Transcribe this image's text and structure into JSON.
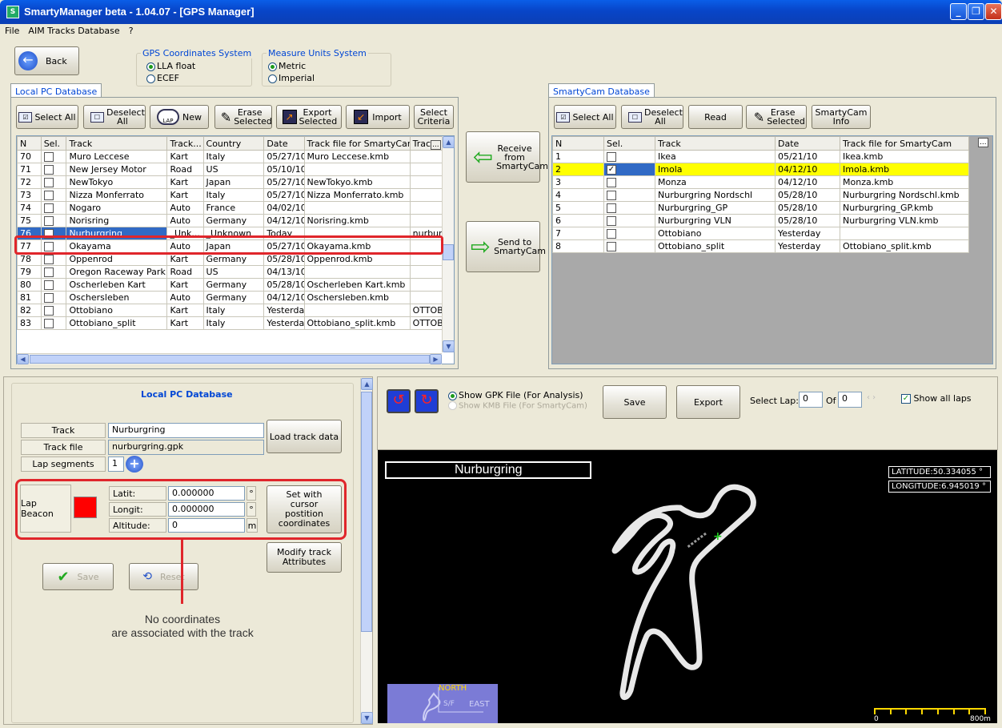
{
  "window": {
    "title": "SmartyManager beta - 1.04.07 - [GPS Manager]"
  },
  "menu": [
    "File",
    "AIM Tracks Database",
    "?"
  ],
  "top": {
    "back": "Back",
    "gps_group": "GPS Coordinates System",
    "gps_opts": [
      "LLA float",
      "ECEF"
    ],
    "units_group": "Measure Units System",
    "units_opts": [
      "Metric",
      "Imperial"
    ]
  },
  "local": {
    "tab": "Local PC Database",
    "toolbar": {
      "select_all": "Select All",
      "deselect_all": "Deselect All",
      "new": "New",
      "erase": "Erase Selected",
      "export": "Export Selected",
      "import": "Import",
      "criteria": "Select Criteria"
    },
    "columns": [
      "N",
      "Sel.",
      "Track",
      "Track...",
      "Country",
      "Date",
      "Track file for SmartyCam",
      "Trac"
    ],
    "rows": [
      [
        "70",
        "",
        "Muro Leccese",
        "Kart",
        "Italy",
        "05/27/10",
        "Muro Leccese.kmb",
        ""
      ],
      [
        "71",
        "",
        "New Jersey Motor",
        "Road",
        "US",
        "05/10/10",
        "",
        ""
      ],
      [
        "72",
        "",
        "NewTokyo",
        "Kart",
        "Japan",
        "05/27/10",
        "NewTokyo.kmb",
        ""
      ],
      [
        "73",
        "",
        "Nizza Monferrato",
        "Kart",
        "Italy",
        "05/27/10",
        "Nizza Monferrato.kmb",
        ""
      ],
      [
        "74",
        "",
        "Nogaro",
        "Auto",
        "France",
        "04/02/10",
        "",
        ""
      ],
      [
        "75",
        "",
        "Norisring",
        "Auto",
        "Germany",
        "04/12/10",
        "Norisring.kmb",
        ""
      ],
      [
        "76",
        "",
        "Nurburgring",
        "_Unk...",
        "_Unknown",
        "Today",
        "",
        "nurburgr"
      ],
      [
        "77",
        "",
        "Okayama",
        "Auto",
        "Japan",
        "05/27/10",
        "Okayama.kmb",
        ""
      ],
      [
        "78",
        "",
        "Oppenrod",
        "Kart",
        "Germany",
        "05/28/10",
        "Oppenrod.kmb",
        ""
      ],
      [
        "79",
        "",
        "Oregon Raceway Park",
        "Road",
        "US",
        "04/13/10",
        "",
        ""
      ],
      [
        "80",
        "",
        "Oscherleben Kart",
        "Kart",
        "Germany",
        "05/28/10",
        "Oscherleben Kart.kmb",
        ""
      ],
      [
        "81",
        "",
        "Oschersleben",
        "Auto",
        "Germany",
        "04/12/10",
        "Oschersleben.kmb",
        ""
      ],
      [
        "82",
        "",
        "Ottobiano",
        "Kart",
        "Italy",
        "Yesterday",
        "",
        "OTTOBIA"
      ],
      [
        "83",
        "",
        "Ottobiano_split",
        "Kart",
        "Italy",
        "Yesterday",
        "Ottobiano_split.kmb",
        "OTTOBIA"
      ]
    ]
  },
  "transfer": {
    "receive": "Receive from SmartyCam",
    "send": "Send to SmartyCam"
  },
  "cam": {
    "tab": "SmartyCam Database",
    "toolbar": {
      "select_all": "Select All",
      "deselect_all": "Deselect All",
      "read": "Read",
      "erase": "Erase Selected",
      "info": "SmartyCam Info"
    },
    "columns": [
      "N",
      "Sel.",
      "Track",
      "Date",
      "Track file for SmartyCam"
    ],
    "rows": [
      [
        "1",
        "",
        "Ikea",
        "05/21/10",
        "Ikea.kmb"
      ],
      [
        "2",
        "checked",
        "Imola",
        "04/12/10",
        "Imola.kmb"
      ],
      [
        "3",
        "",
        "Monza",
        "04/12/10",
        "Monza.kmb"
      ],
      [
        "4",
        "",
        "Nurburgring Nordschl",
        "05/28/10",
        "Nurburgring Nordschl.kmb"
      ],
      [
        "5",
        "",
        "Nurburgring_GP",
        "05/28/10",
        "Nurburgring_GP.kmb"
      ],
      [
        "6",
        "",
        "Nurburgring VLN",
        "05/28/10",
        "Nurburgring VLN.kmb"
      ],
      [
        "7",
        "",
        "Ottobiano",
        "Yesterday",
        ""
      ],
      [
        "8",
        "",
        "Ottobiano_split",
        "Yesterday",
        "Ottobiano_split.kmb"
      ]
    ]
  },
  "detail": {
    "title": "Local PC Database",
    "track_lbl": "Track",
    "track_val": "Nurburgring",
    "file_lbl": "Track file",
    "file_val": "nurburgring.gpk",
    "seg_lbl": "Lap segments",
    "seg_val": "1",
    "load": "Load track data",
    "beacon": "Lap Beacon",
    "lat_lbl": "Latit:",
    "lat_val": "0.000000",
    "lon_lbl": "Longit:",
    "lon_val": "0.000000",
    "alt_lbl": "Altitude:",
    "alt_val": "0",
    "deg": "°",
    "m": "m",
    "set_cursor": "Set with cursor postition coordinates",
    "modify": "Modify track Attributes",
    "save": "Save",
    "reset": "Reset",
    "note1": "No coordinates",
    "note2": "are associated with the track",
    "beacon_color": "#ff0000"
  },
  "viewer": {
    "opt1": "Show GPK File (For Analysis)",
    "opt2": "Show KMB File (For SmartyCam)",
    "save": "Save",
    "export": "Export",
    "select_lap": "Select Lap:",
    "lap_val": "0",
    "of": "Of",
    "of_val": "0",
    "show_all": "Show all laps",
    "track_name": "Nurburgring",
    "latitude": "LATITUDE:50.334055 °",
    "longitude": "LONGITUDE:6.945019 °",
    "north": "NORTH",
    "east": "EAST",
    "sf": "S/F",
    "scale0": "0",
    "scale1": "800m"
  }
}
